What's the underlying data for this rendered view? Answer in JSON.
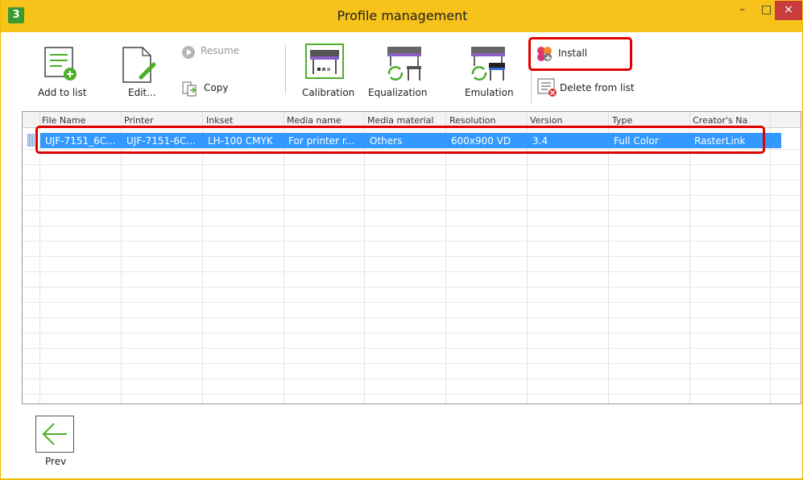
{
  "window": {
    "title": "Profile management",
    "app_icon_text": "3",
    "controls": {
      "minimize": "–",
      "maximize": "□",
      "close": "×"
    }
  },
  "toolbar": {
    "add_to_list": "Add to list",
    "edit": "Edit...",
    "resume": "Resume",
    "copy": "Copy",
    "calibration": "Calibration",
    "equalization": "Equalization",
    "emulation": "Emulation",
    "install": "Install",
    "delete_from_list": "Delete from list"
  },
  "table": {
    "columns": [
      "File Name",
      "Printer",
      "Inkset",
      "Media name",
      "Media material",
      "Resolution",
      "Version",
      "Type",
      "Creator's Na"
    ],
    "rows": [
      [
        "UJF-7151_6C...",
        "UJF-7151-6C...",
        "LH-100 CMYK",
        "For printer r...",
        "Others",
        "600x900 VD",
        "3.4",
        "Full Color",
        "RasterLink"
      ]
    ]
  },
  "footer": {
    "prev": "Prev"
  },
  "colors": {
    "titlebar": "#f7c21a",
    "selection": "#3399ff",
    "highlight": "#e00000",
    "accent_green": "#4caf2a"
  }
}
